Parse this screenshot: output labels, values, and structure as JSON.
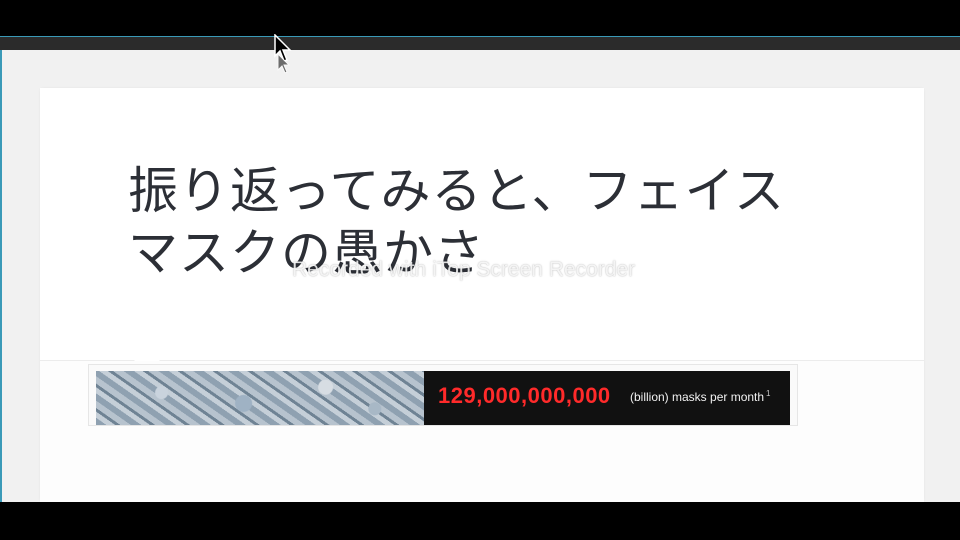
{
  "article": {
    "title_line1": "振り返ってみると、フェイス",
    "title_line2": "マスクの愚かさ"
  },
  "banner": {
    "number": "129,000,000,000",
    "caption": "(billion) masks per month",
    "footnote": "1",
    "number_color": "#ff2a2a"
  },
  "overlay": {
    "watermark": "Recorded with iTop Screen Recorder"
  },
  "icons": {
    "cursor": "mouse-pointer-icon"
  }
}
